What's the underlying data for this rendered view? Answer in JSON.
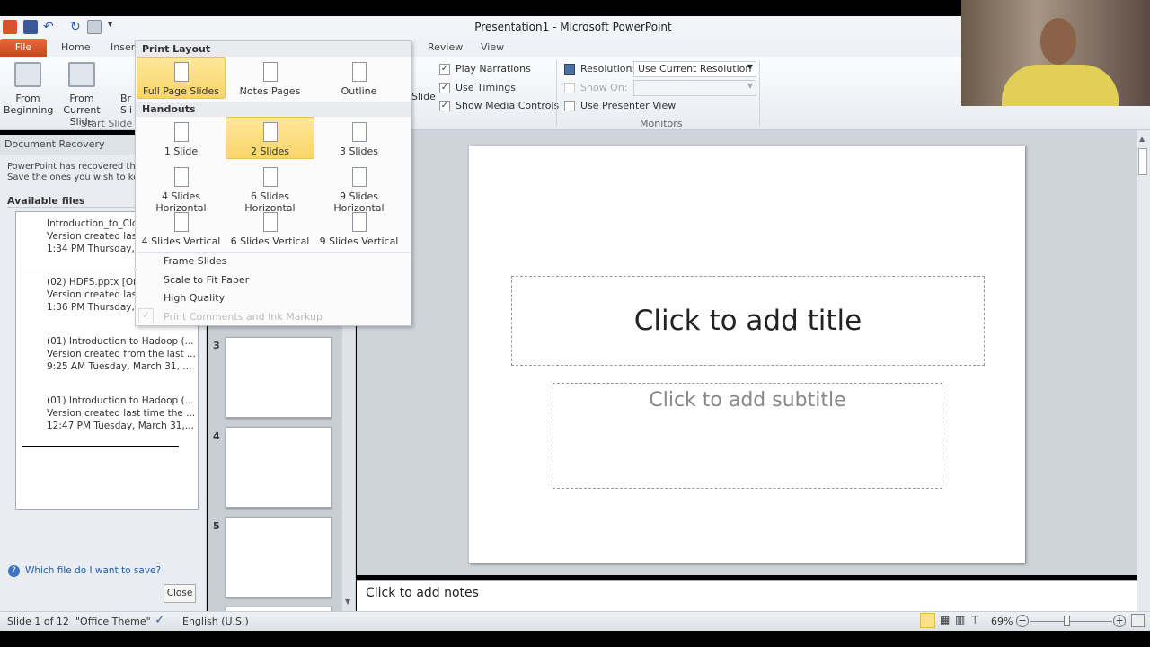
{
  "window": {
    "title": "Presentation1  -  Microsoft PowerPoint"
  },
  "tabs": {
    "file": "File",
    "home": "Home",
    "insert": "Insert",
    "review": "Review",
    "view": "View"
  },
  "ribbon": {
    "from_beginning": [
      "From",
      "Beginning"
    ],
    "from_current": [
      "From",
      "Current Slide"
    ],
    "broadcast_partial": [
      "Br",
      "Sli"
    ],
    "group_start": "Start Slide S",
    "slide_partial": "Slide",
    "play_narrations": "Play Narrations",
    "use_timings": "Use Timings",
    "show_media_controls": "Show Media Controls",
    "resolution_label": "Resolution:",
    "resolution_value": "Use Current Resolution",
    "show_on_label": "Show On:",
    "use_presenter_view": "Use Presenter View",
    "group_monitors": "Monitors"
  },
  "menu": {
    "print_layout": "Print Layout",
    "layouts": [
      "Full Page Slides",
      "Notes Pages",
      "Outline"
    ],
    "handouts": "Handouts",
    "handout_items": [
      "1 Slide",
      "2 Slides",
      "3 Slides",
      "4 Slides Horizontal",
      "6 Slides Horizontal",
      "9 Slides Horizontal",
      "4 Slides Vertical",
      "6 Slides Vertical",
      "9 Slides Vertical"
    ],
    "options": [
      "Frame Slides",
      "Scale to Fit Paper",
      "High Quality",
      "Print Comments and Ink Markup"
    ],
    "selected_layout": "Full Page Slides",
    "selected_handout": "2 Slides"
  },
  "recovery": {
    "title": "Document Recovery",
    "message": [
      "PowerPoint has recovered the f",
      "Save the ones you wish to keep"
    ],
    "available": "Available files",
    "files": [
      {
        "name": "Introduction_to_Cloud",
        "desc": "Version created last ti",
        "time": "1:34 PM Thursday, Ap"
      },
      {
        "name": "(02) HDFS.pptx  [Orig",
        "desc": "Version created last ti",
        "time": "1:36 PM Thursday, Ap"
      },
      {
        "name": "(01) Introduction to Hadoop (...",
        "desc": "Version created from the last ...",
        "time": "9:25 AM Tuesday, March 31, ..."
      },
      {
        "name": "(01) Introduction to Hadoop (...",
        "desc": "Version created last time the ...",
        "time": "12:47 PM Tuesday, March 31,..."
      }
    ],
    "help": "Which file do I want to save?",
    "close": "Close"
  },
  "thumbs": [
    "3",
    "4",
    "5"
  ],
  "slide": {
    "title": "Click to add title",
    "subtitle": "Click to add subtitle"
  },
  "notes": "Click to add notes",
  "status": {
    "slide": "Slide 1 of 12",
    "theme": "\"Office Theme\"",
    "language": "English (U.S.)",
    "zoom": "69%",
    "zoom_percent": 69
  }
}
